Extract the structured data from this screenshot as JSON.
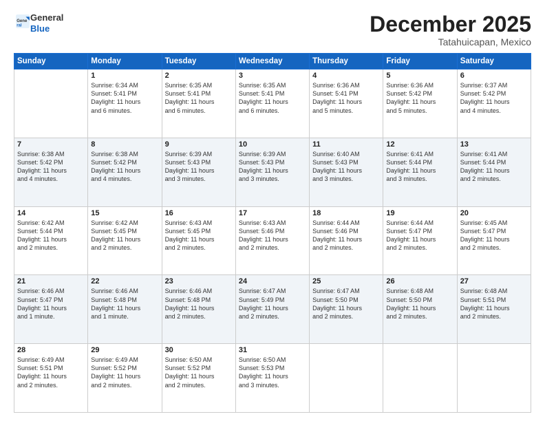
{
  "header": {
    "logo_general": "General",
    "logo_blue": "Blue",
    "month_title": "December 2025",
    "location": "Tatahuicapan, Mexico"
  },
  "days_of_week": [
    "Sunday",
    "Monday",
    "Tuesday",
    "Wednesday",
    "Thursday",
    "Friday",
    "Saturday"
  ],
  "weeks": [
    [
      {
        "day": "",
        "info": ""
      },
      {
        "day": "1",
        "info": "Sunrise: 6:34 AM\nSunset: 5:41 PM\nDaylight: 11 hours\nand 6 minutes."
      },
      {
        "day": "2",
        "info": "Sunrise: 6:35 AM\nSunset: 5:41 PM\nDaylight: 11 hours\nand 6 minutes."
      },
      {
        "day": "3",
        "info": "Sunrise: 6:35 AM\nSunset: 5:41 PM\nDaylight: 11 hours\nand 6 minutes."
      },
      {
        "day": "4",
        "info": "Sunrise: 6:36 AM\nSunset: 5:41 PM\nDaylight: 11 hours\nand 5 minutes."
      },
      {
        "day": "5",
        "info": "Sunrise: 6:36 AM\nSunset: 5:42 PM\nDaylight: 11 hours\nand 5 minutes."
      },
      {
        "day": "6",
        "info": "Sunrise: 6:37 AM\nSunset: 5:42 PM\nDaylight: 11 hours\nand 4 minutes."
      }
    ],
    [
      {
        "day": "7",
        "info": "Sunrise: 6:38 AM\nSunset: 5:42 PM\nDaylight: 11 hours\nand 4 minutes."
      },
      {
        "day": "8",
        "info": "Sunrise: 6:38 AM\nSunset: 5:42 PM\nDaylight: 11 hours\nand 4 minutes."
      },
      {
        "day": "9",
        "info": "Sunrise: 6:39 AM\nSunset: 5:43 PM\nDaylight: 11 hours\nand 3 minutes."
      },
      {
        "day": "10",
        "info": "Sunrise: 6:39 AM\nSunset: 5:43 PM\nDaylight: 11 hours\nand 3 minutes."
      },
      {
        "day": "11",
        "info": "Sunrise: 6:40 AM\nSunset: 5:43 PM\nDaylight: 11 hours\nand 3 minutes."
      },
      {
        "day": "12",
        "info": "Sunrise: 6:41 AM\nSunset: 5:44 PM\nDaylight: 11 hours\nand 3 minutes."
      },
      {
        "day": "13",
        "info": "Sunrise: 6:41 AM\nSunset: 5:44 PM\nDaylight: 11 hours\nand 2 minutes."
      }
    ],
    [
      {
        "day": "14",
        "info": "Sunrise: 6:42 AM\nSunset: 5:44 PM\nDaylight: 11 hours\nand 2 minutes."
      },
      {
        "day": "15",
        "info": "Sunrise: 6:42 AM\nSunset: 5:45 PM\nDaylight: 11 hours\nand 2 minutes."
      },
      {
        "day": "16",
        "info": "Sunrise: 6:43 AM\nSunset: 5:45 PM\nDaylight: 11 hours\nand 2 minutes."
      },
      {
        "day": "17",
        "info": "Sunrise: 6:43 AM\nSunset: 5:46 PM\nDaylight: 11 hours\nand 2 minutes."
      },
      {
        "day": "18",
        "info": "Sunrise: 6:44 AM\nSunset: 5:46 PM\nDaylight: 11 hours\nand 2 minutes."
      },
      {
        "day": "19",
        "info": "Sunrise: 6:44 AM\nSunset: 5:47 PM\nDaylight: 11 hours\nand 2 minutes."
      },
      {
        "day": "20",
        "info": "Sunrise: 6:45 AM\nSunset: 5:47 PM\nDaylight: 11 hours\nand 2 minutes."
      }
    ],
    [
      {
        "day": "21",
        "info": "Sunrise: 6:46 AM\nSunset: 5:47 PM\nDaylight: 11 hours\nand 1 minute."
      },
      {
        "day": "22",
        "info": "Sunrise: 6:46 AM\nSunset: 5:48 PM\nDaylight: 11 hours\nand 1 minute."
      },
      {
        "day": "23",
        "info": "Sunrise: 6:46 AM\nSunset: 5:48 PM\nDaylight: 11 hours\nand 2 minutes."
      },
      {
        "day": "24",
        "info": "Sunrise: 6:47 AM\nSunset: 5:49 PM\nDaylight: 11 hours\nand 2 minutes."
      },
      {
        "day": "25",
        "info": "Sunrise: 6:47 AM\nSunset: 5:50 PM\nDaylight: 11 hours\nand 2 minutes."
      },
      {
        "day": "26",
        "info": "Sunrise: 6:48 AM\nSunset: 5:50 PM\nDaylight: 11 hours\nand 2 minutes."
      },
      {
        "day": "27",
        "info": "Sunrise: 6:48 AM\nSunset: 5:51 PM\nDaylight: 11 hours\nand 2 minutes."
      }
    ],
    [
      {
        "day": "28",
        "info": "Sunrise: 6:49 AM\nSunset: 5:51 PM\nDaylight: 11 hours\nand 2 minutes."
      },
      {
        "day": "29",
        "info": "Sunrise: 6:49 AM\nSunset: 5:52 PM\nDaylight: 11 hours\nand 2 minutes."
      },
      {
        "day": "30",
        "info": "Sunrise: 6:50 AM\nSunset: 5:52 PM\nDaylight: 11 hours\nand 2 minutes."
      },
      {
        "day": "31",
        "info": "Sunrise: 6:50 AM\nSunset: 5:53 PM\nDaylight: 11 hours\nand 3 minutes."
      },
      {
        "day": "",
        "info": ""
      },
      {
        "day": "",
        "info": ""
      },
      {
        "day": "",
        "info": ""
      }
    ]
  ]
}
